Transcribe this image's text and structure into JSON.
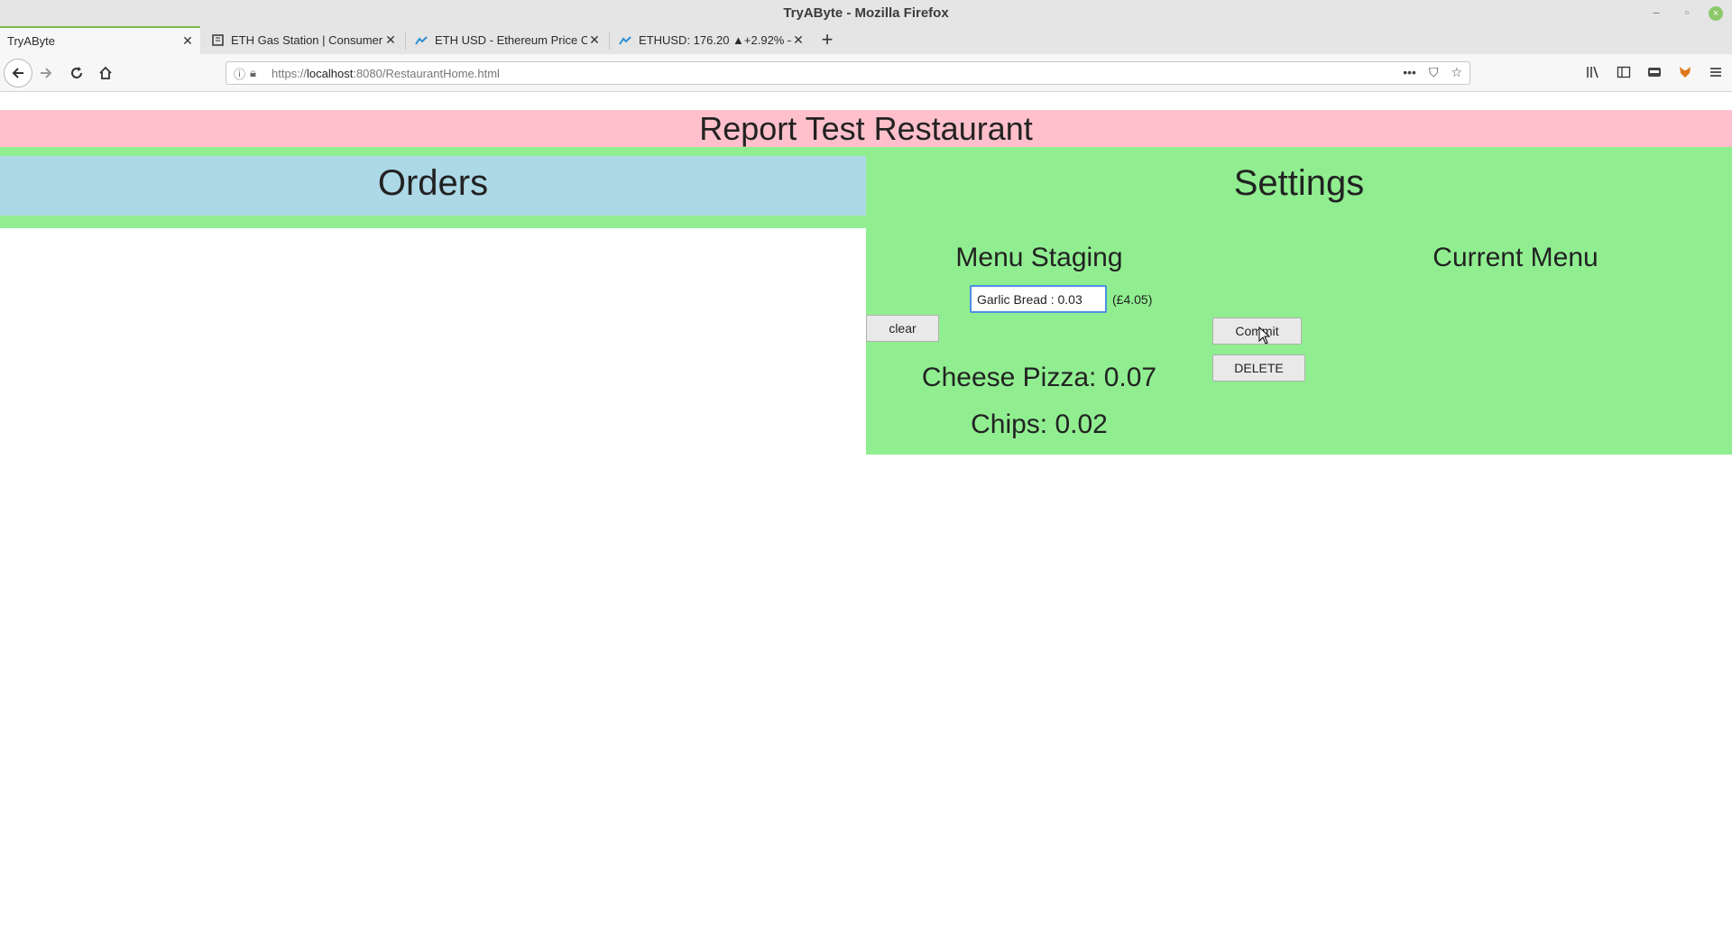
{
  "browser": {
    "window_title": "TryAByte - Mozilla Firefox",
    "tabs": [
      {
        "label": "TryAByte",
        "active": true
      },
      {
        "label": "ETH Gas Station | Consumer",
        "active": false
      },
      {
        "label": "ETH USD - Ethereum Price Ch",
        "active": false
      },
      {
        "label": "ETHUSD: 176.20 ▲+2.92% —",
        "active": false
      }
    ],
    "url": {
      "scheme": "https://",
      "host": "localhost",
      "rest": ":8080/RestaurantHome.html"
    }
  },
  "page": {
    "restaurant_name": "Report Test Restaurant",
    "orders": {
      "title": "Orders"
    },
    "settings": {
      "title": "Settings",
      "menu_staging": {
        "title": "Menu Staging",
        "input_value": "Garlic Bread : 0.03",
        "gbp_price": "(£4.05)",
        "clear_label": "clear",
        "items": [
          "Cheese Pizza: 0.07",
          "Chips: 0.02"
        ]
      },
      "current_menu": {
        "title": "Current Menu",
        "commit_label": "Commit",
        "delete_label": "DELETE"
      }
    }
  },
  "colors": {
    "header_pink": "#ffc0cb",
    "orders_blue": "#add8e6",
    "panel_green": "#90ee90"
  }
}
